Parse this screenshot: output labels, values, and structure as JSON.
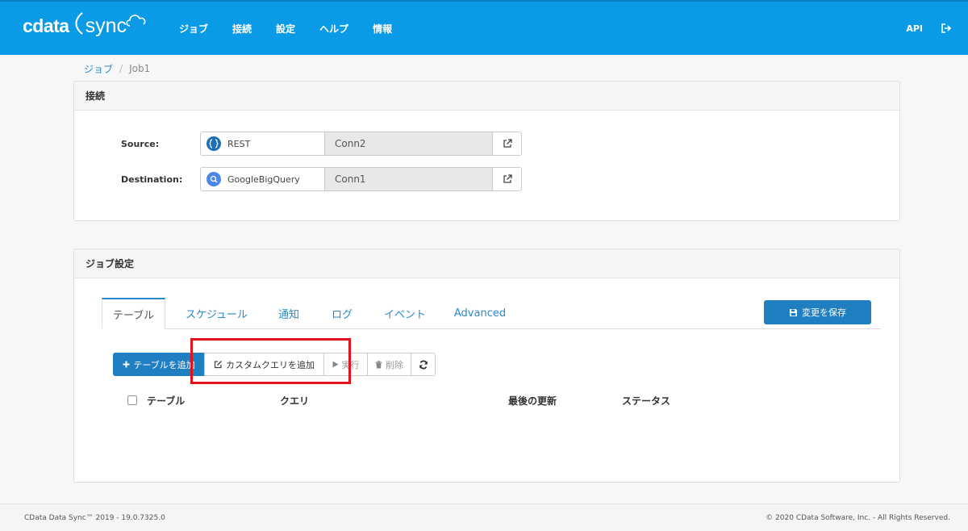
{
  "navbar": {
    "logo_cdata": "cdata",
    "logo_sync": "sync",
    "menu": [
      "ジョブ",
      "接続",
      "設定",
      "ヘルプ",
      "情報"
    ],
    "api": "API",
    "bg_color": "#0b9be6"
  },
  "breadcrumb": {
    "parent": "ジョブ",
    "sep": "/",
    "current": "Job1"
  },
  "connections_panel": {
    "title": "接続",
    "source": {
      "label": "Source:",
      "type": "REST",
      "name": "Conn2",
      "icon": "rest-icon"
    },
    "destination": {
      "label": "Destination:",
      "type": "GoogleBigQuery",
      "name": "Conn1",
      "icon": "bigquery-icon"
    }
  },
  "job_panel": {
    "title": "ジョブ設定",
    "tabs": [
      "テーブル",
      "スケジュール",
      "通知",
      "ログ",
      "イベント",
      "Advanced"
    ],
    "active_tab": "テーブル",
    "save_label": "変更を保存",
    "toolbar": {
      "add_table": "テーブルを追加",
      "add_custom_query": "カスタムクエリを追加",
      "run": "実行",
      "delete": "削除"
    },
    "table_headers": [
      "テーブル",
      "クエリ",
      "最後の更新",
      "ステータス"
    ]
  },
  "footer": {
    "left": "CData Data Sync™ 2019 - 19.0.7325.0",
    "right": "© 2020 CData Software, Inc. - All Rights Reserved."
  },
  "colors": {
    "primary": "#1f7fc1",
    "highlight": "#e3131b"
  }
}
